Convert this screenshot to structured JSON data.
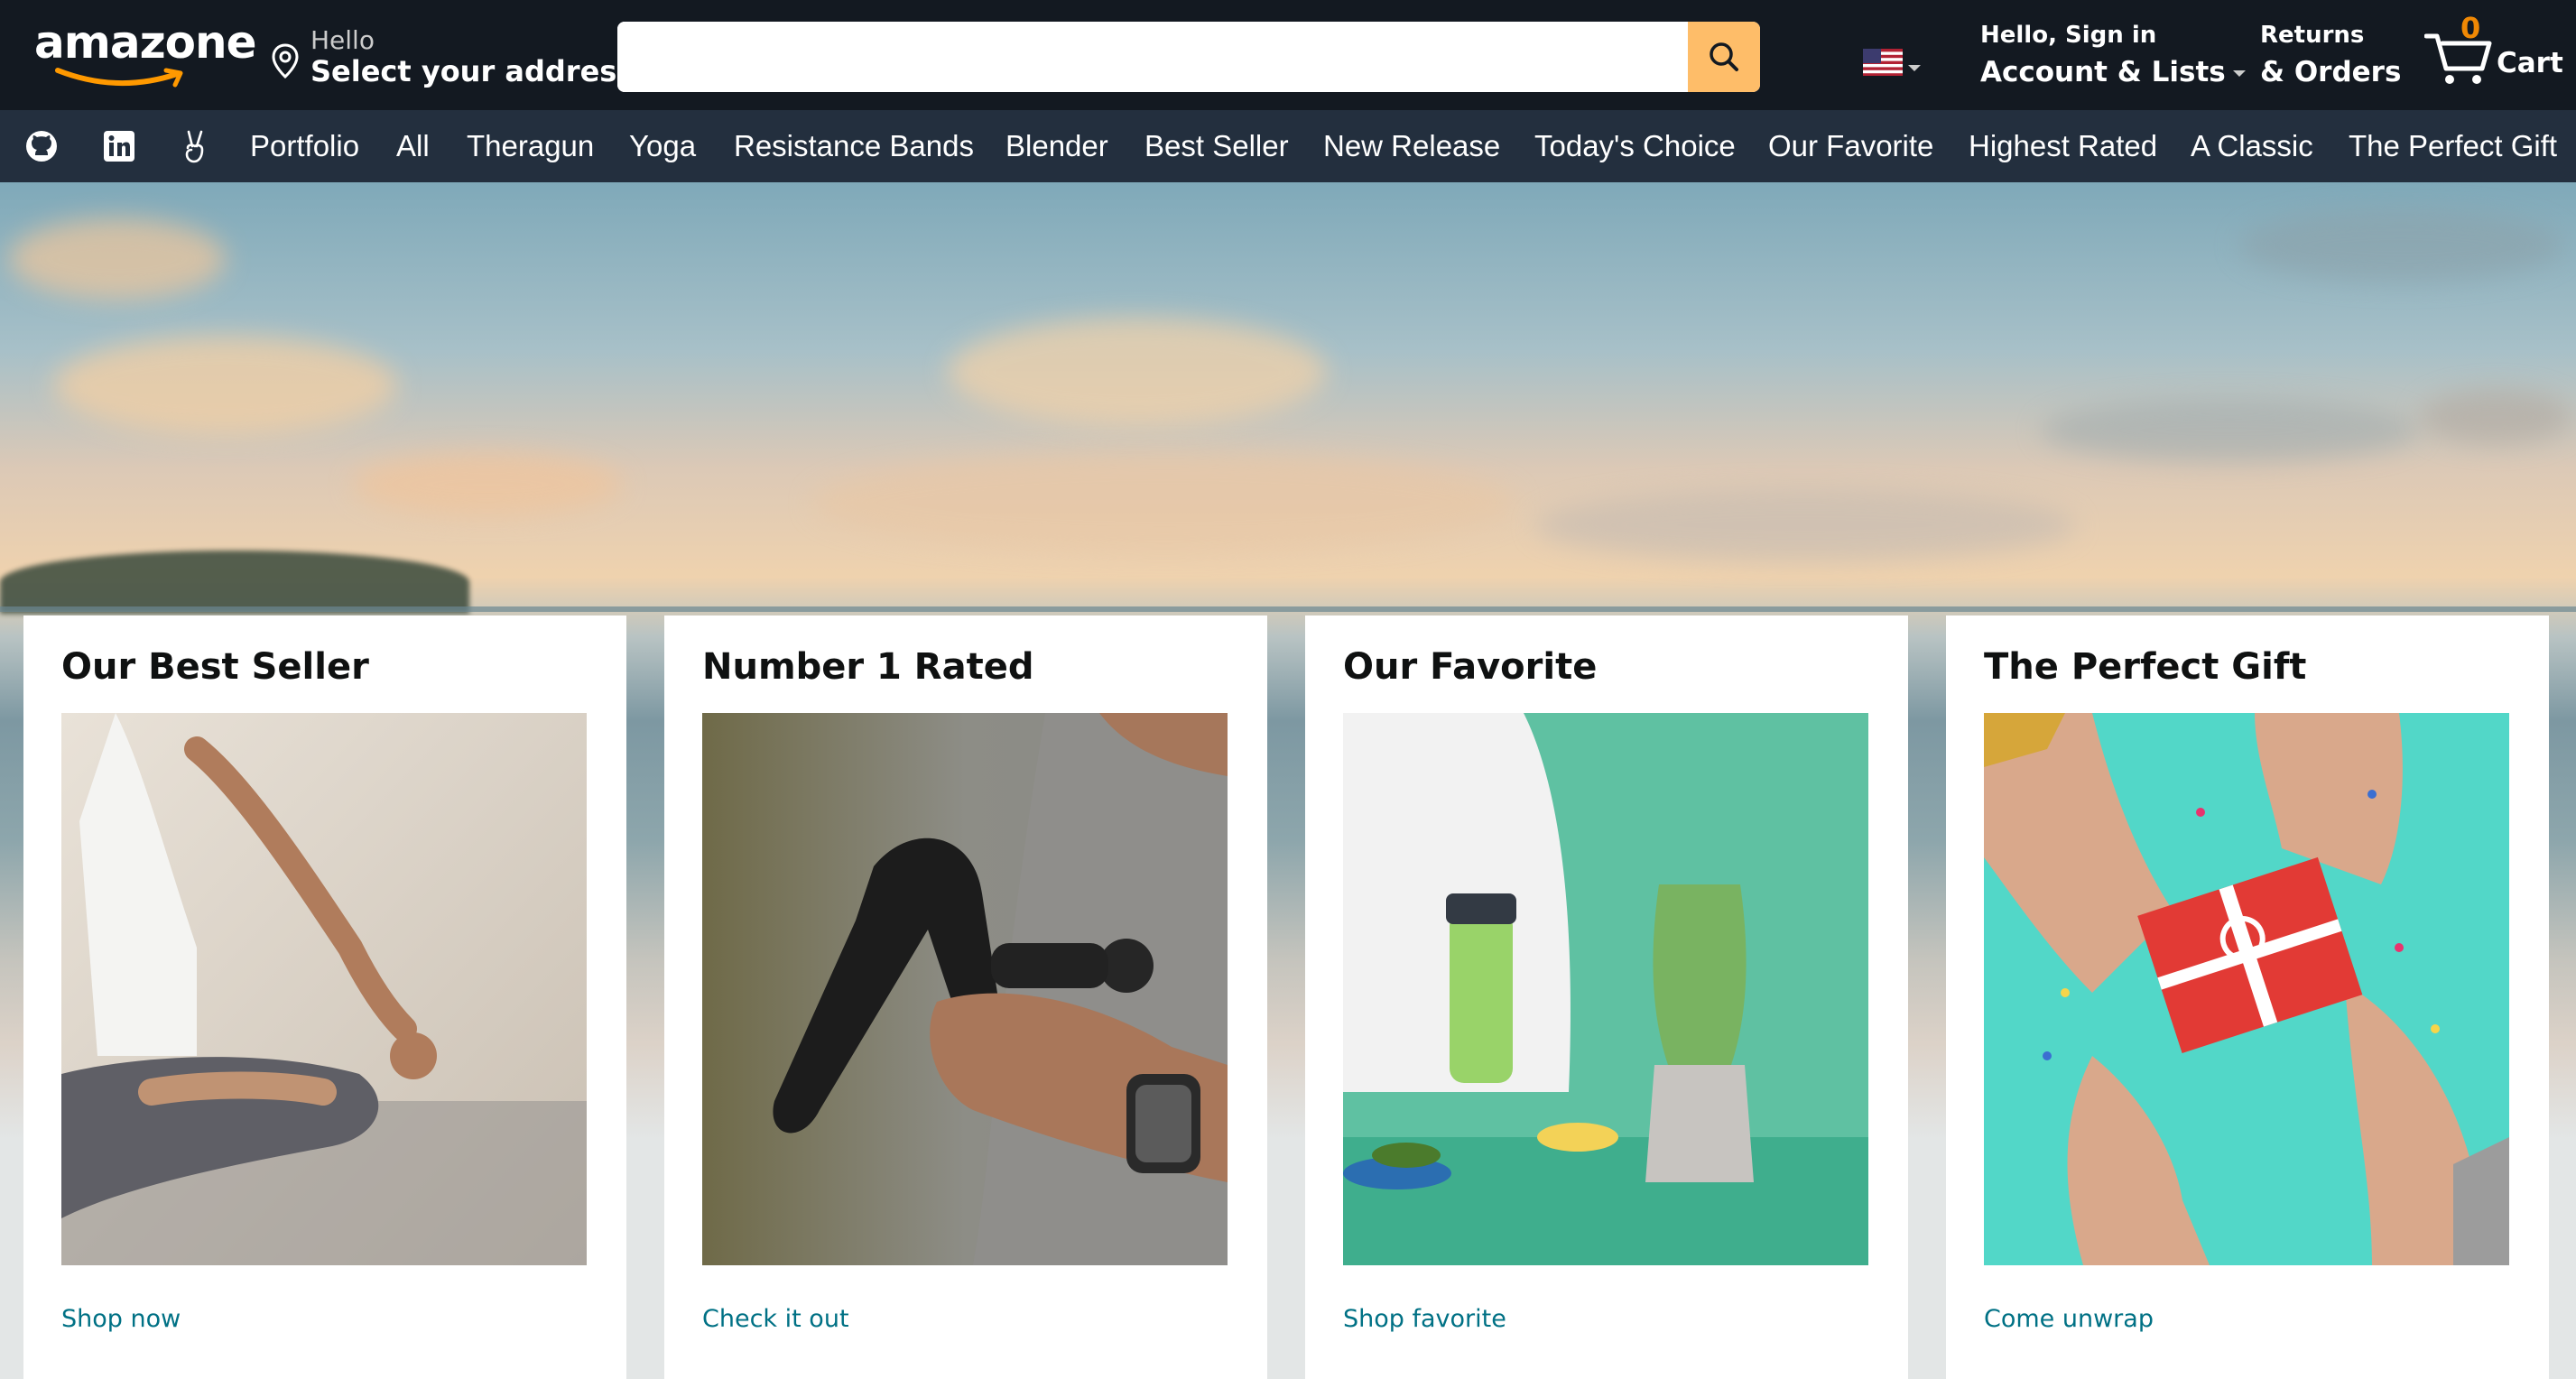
{
  "header": {
    "logo_text": "amazone",
    "address_greeting": "Hello",
    "address_prompt": "Select your address",
    "search": {
      "value": "",
      "placeholder": ""
    },
    "account_line1": "Hello, Sign in",
    "account_line2": "Account & Lists",
    "returns_line1": "Returns",
    "returns_line2": "& Orders",
    "cart_count": "0",
    "cart_label": "Cart"
  },
  "nav": {
    "icons": [
      "github-icon",
      "linkedin-icon",
      "peace-hand-icon"
    ],
    "links": [
      "Portfolio",
      "All",
      "Theragun",
      "Yoga",
      "Resistance Bands",
      "Blender",
      "Best Seller",
      "New Release",
      "Today's Choice",
      "Our Favorite",
      "Highest Rated",
      "A Classic",
      "The Perfect Gift"
    ]
  },
  "cards": [
    {
      "title": "Our Best Seller",
      "link": "Shop now",
      "image": "yoga-meditation-photo"
    },
    {
      "title": "Number 1 Rated",
      "link": "Check it out",
      "image": "theragun-massage-photo"
    },
    {
      "title": "Our Favorite",
      "link": "Shop favorite",
      "image": "nutribullet-blender-photo"
    },
    {
      "title": "The Perfect Gift",
      "link": "Come unwrap",
      "image": "gift-box-hands-photo"
    }
  ],
  "colors": {
    "header_bg": "#131921",
    "nav_bg": "#232f3e",
    "search_button": "#febd69",
    "cart_count": "#f08804",
    "link": "#007185",
    "logo_smile": "#ff9900"
  }
}
